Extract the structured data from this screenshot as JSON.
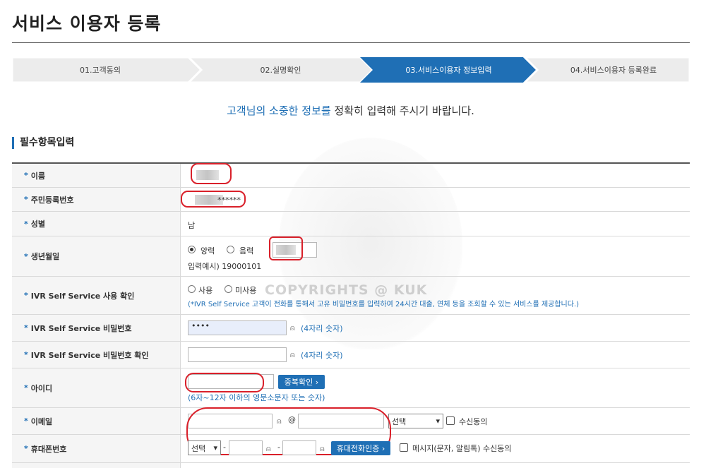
{
  "page": {
    "title": "서비스 이용자 등록"
  },
  "steps": [
    {
      "label": "01.고객동의"
    },
    {
      "label": "02.실명확인"
    },
    {
      "label": "03.서비스이용자 정보입력"
    },
    {
      "label": "04.서비스이용자 등록완료"
    }
  ],
  "intro": {
    "highlight": "고객님의 소중한 정보를",
    "rest": " 정확히 입력해 주시기 바랍니다."
  },
  "section": {
    "title": "필수항목입력"
  },
  "rows": {
    "name": {
      "label": "이름"
    },
    "rrn": {
      "label": "주민등록번호",
      "masked": "******"
    },
    "gender": {
      "label": "성별",
      "value": "남"
    },
    "birth": {
      "label": "생년월일",
      "solar": "양력",
      "lunar": "음력",
      "example": "입력예시) 19000101"
    },
    "ivr_use": {
      "label": "IVR Self Service 사용 확인",
      "use": "사용",
      "not_use": "미사용",
      "note": "(*IVR Self Service 고객이 전화를 통해서 고유 비밀번호를 입력하여 24시간 대출, 연체 등을 조회할 수 있는 서비스를 제공합니다.)"
    },
    "ivr_pw": {
      "label": "IVR Self Service 비밀번호",
      "value": "••••",
      "hint": "(4자리 숫자)"
    },
    "ivr_pw_confirm": {
      "label": "IVR Self Service 비밀번호 확인",
      "hint": "(4자리 숫자)"
    },
    "userid": {
      "label": "아이디",
      "button": "중복확인 ›",
      "hint": "(6자~12자 이하의 영문소문자 또는 숫자)"
    },
    "email": {
      "label": "이메일",
      "at": "@",
      "select": "선택",
      "consent": "수신동의"
    },
    "mobile": {
      "label": "휴대폰번호",
      "select": "선택",
      "dash": "-",
      "button": "휴대전화인증 ›",
      "consent": "메시지(문자, 알림톡) 수신동의"
    }
  },
  "watermark": "COPYRIGHTS @ KUK",
  "colors": {
    "accent": "#1f6fb5",
    "alert": "#d9202a"
  }
}
